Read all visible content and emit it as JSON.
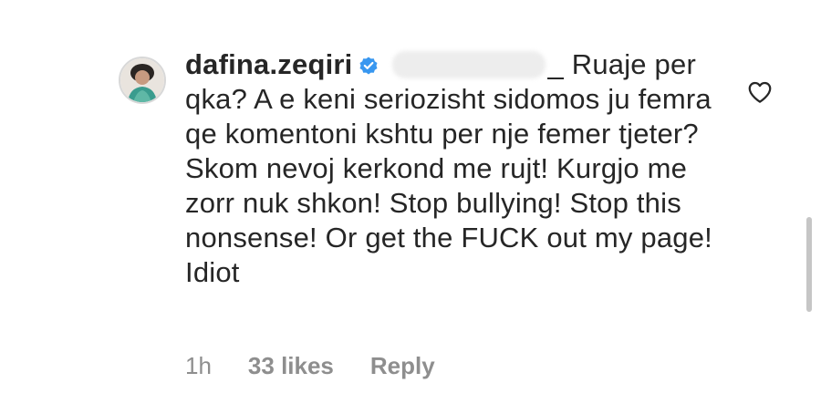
{
  "comment": {
    "username": "dafina.zeqiri",
    "mention_suffix": "_",
    "text": "Ruaje per qka? A e keni seriozisht sidomos ju femra qe komentoni kshtu per nje femer tjeter? Skom nevoj kerkond me rujt! Kurgjo me zorr nuk shkon! Stop bullying! Stop this nonsense! Or get the FUCK out my page! Idiot",
    "time": "1h",
    "likes": "33 likes",
    "reply_label": "Reply"
  },
  "icons": {
    "verified": "verified-badge-icon",
    "like": "heart-outline-icon",
    "avatar": "profile-avatar"
  },
  "colors": {
    "text": "#262626",
    "meta": "#8e8e8e",
    "verified": "#3897f0"
  }
}
